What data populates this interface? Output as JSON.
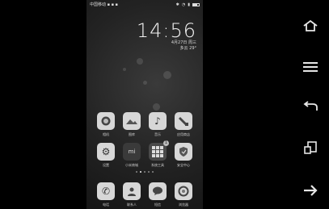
{
  "status_bar": {
    "left_text": "中国移动 ▪ ▪ ▪",
    "right_icons": [
      "bluetooth-icon",
      "wifi-icon",
      "signal-icon",
      "battery-icon"
    ]
  },
  "clock": {
    "time": "14:56",
    "date": "4月27日 周三",
    "weather": "多云 29°"
  },
  "apps_row1": [
    {
      "label": "相机",
      "icon": "camera-icon"
    },
    {
      "label": "图库",
      "icon": "gallery-icon"
    },
    {
      "label": "音乐",
      "icon": "music-icon"
    },
    {
      "label": "应用商店",
      "icon": "store-icon"
    }
  ],
  "apps_row2": [
    {
      "label": "设置",
      "icon": "gear-icon"
    },
    {
      "label": "小米商城",
      "icon": "mi-store-icon"
    },
    {
      "label": "系统工具",
      "icon": "tools-folder-icon",
      "badge": "1"
    },
    {
      "label": "安全中心",
      "icon": "shield-icon"
    }
  ],
  "dock": [
    {
      "label": "电话",
      "icon": "phone-icon"
    },
    {
      "label": "联系人",
      "icon": "contacts-icon"
    },
    {
      "label": "短信",
      "icon": "message-icon"
    },
    {
      "label": "浏览器",
      "icon": "browser-icon"
    }
  ],
  "page_indicator": {
    "count": 5,
    "active": 1
  },
  "nav": {
    "buttons": [
      "home-icon",
      "menu-icon",
      "back-icon",
      "rotate-icon",
      "forward-icon"
    ]
  }
}
